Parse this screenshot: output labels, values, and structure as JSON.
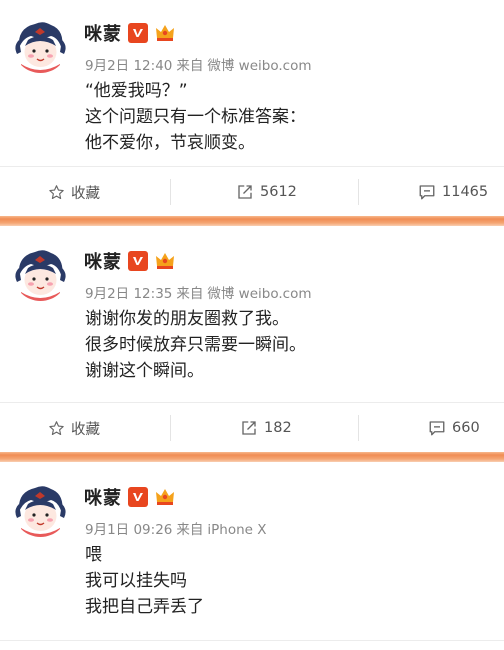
{
  "posts": [
    {
      "username": "咪蒙",
      "date": "9月2日 12:40",
      "from_label": "来自",
      "source": "微博 weibo.com",
      "lines": [
        "“他爱我吗？”",
        "这个问题只有一个标准答案：",
        "他不爱你，节哀顺变。"
      ],
      "favorite_label": "收藏",
      "repost_count": "5612",
      "comment_count": "11465"
    },
    {
      "username": "咪蒙",
      "date": "9月2日 12:35",
      "from_label": "来自",
      "source": "微博 weibo.com",
      "lines": [
        "谢谢你发的朋友圈救了我。",
        "很多时候放弃只需要一瞬间。",
        "谢谢这个瞬间。"
      ],
      "favorite_label": "收藏",
      "repost_count": "182",
      "comment_count": "660"
    },
    {
      "username": "咪蒙",
      "date": "9月1日 09:26",
      "from_label": "来自",
      "source": "iPhone X",
      "lines": [
        "喂",
        "我可以挂失吗",
        "我把自己弄丢了"
      ]
    }
  ],
  "colors": {
    "divider": "#f08d54",
    "verified_badge": "#e8461f",
    "meta_text": "#888888"
  },
  "icons": {
    "favorite": "star-outline-icon",
    "repost": "share-arrow-icon",
    "comment": "speech-bubble-icon",
    "verified": "verified-v-icon",
    "vip": "crown-vip-icon"
  }
}
